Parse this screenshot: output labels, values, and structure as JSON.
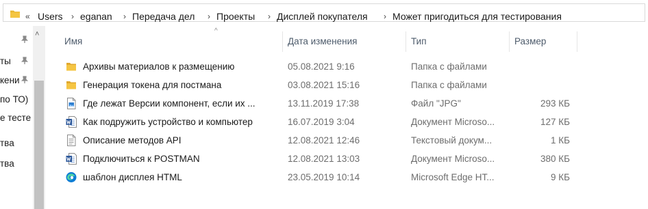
{
  "address_bar": {
    "overflow_chevron": "«",
    "separator": "›",
    "crumbs": [
      "Users",
      "eganan",
      "Передача дел",
      "Проекты",
      "Дисплей покупателя",
      "Может пригодиться для тестирования"
    ]
  },
  "nav_pane": {
    "items": [
      "ты",
      "кени",
      "по ТО)",
      "е тесте",
      "тва",
      "тва"
    ],
    "scroll_up": "˄"
  },
  "columns": {
    "sort_indicator": "^",
    "name": "Имя",
    "date": "Дата изменения",
    "type": "Тип",
    "size": "Размер"
  },
  "files": [
    {
      "name": "Архивы материалов к размещению",
      "date": "05.08.2021 9:16",
      "type": "Папка с файлами",
      "size": "",
      "icon": "folder-icon"
    },
    {
      "name": "Генерация токена для постмана",
      "date": "03.08.2021 15:16",
      "type": "Папка с файлами",
      "size": "",
      "icon": "folder-icon"
    },
    {
      "name": "Где лежат Версии компонент, если их ...",
      "date": "13.11.2019 17:38",
      "type": "Файл \"JPG\"",
      "size": "293 КБ",
      "icon": "jpg-file-icon"
    },
    {
      "name": "Как подружить устройство и компьютер",
      "date": "16.07.2019 3:04",
      "type": "Документ Microso...",
      "size": "127 КБ",
      "icon": "word-doc-icon"
    },
    {
      "name": "Описание методов API",
      "date": "12.08.2021 12:46",
      "type": "Текстовый докум...",
      "size": "1 КБ",
      "icon": "text-file-icon"
    },
    {
      "name": "Подключиться к POSTMAN",
      "date": "12.08.2021 13:03",
      "type": "Документ Microso...",
      "size": "380 КБ",
      "icon": "word-doc-icon"
    },
    {
      "name": "шаблон дисплея HTML",
      "date": "23.05.2019 10:14",
      "type": "Microsoft Edge HT...",
      "size": "9 КБ",
      "icon": "edge-html-icon"
    }
  ],
  "colors": {
    "folder": "#e8b730",
    "word": "#2b579a",
    "edge": "#0c7cd5",
    "header_text": "#4d5b6b",
    "secondary_text": "#6d6d6d"
  }
}
